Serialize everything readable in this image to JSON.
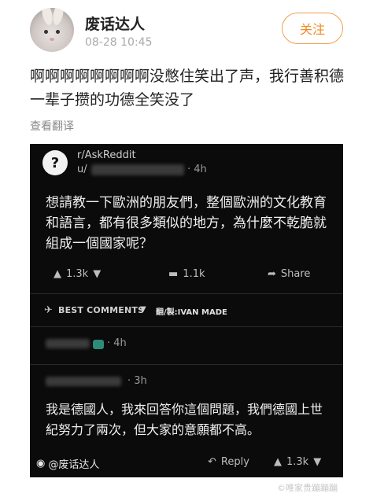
{
  "post": {
    "username": "废话达人",
    "timestamp": "08-28 10:45",
    "follow_label": "关注",
    "text": "啊啊啊啊啊啊啊啊没憋住笑出了声，我行善积德一辈子攒的功德全笑没了",
    "translate_label": "查看翻译"
  },
  "reddit": {
    "subreddit": "r/AskReddit",
    "user_prefix": "u/",
    "post_time": "· 4h",
    "title": "想請教一下歐洲的朋友們，整個歐洲的文化教育和語言，都有很多類似的地方，為什麼不乾脆就組成一個國家呢？",
    "upvotes": "1.3k",
    "comments": "1.1k",
    "share_label": "Share",
    "best_comments_label": "BEST COMMENTS",
    "credit": "翻/製:IVAN MADE",
    "comment1_time": "· 4h",
    "comment2_time": "· 3h",
    "comment_body": "我是德國人，我來回答你這個問題，我們德國上世紀努力了兩次，但大家的意願都不高。",
    "reply_label": "Reply",
    "comment_votes": "1.3k",
    "watermark": "@废话达人"
  },
  "corner_watermark": "©唯家贵蹦蹦蹦"
}
